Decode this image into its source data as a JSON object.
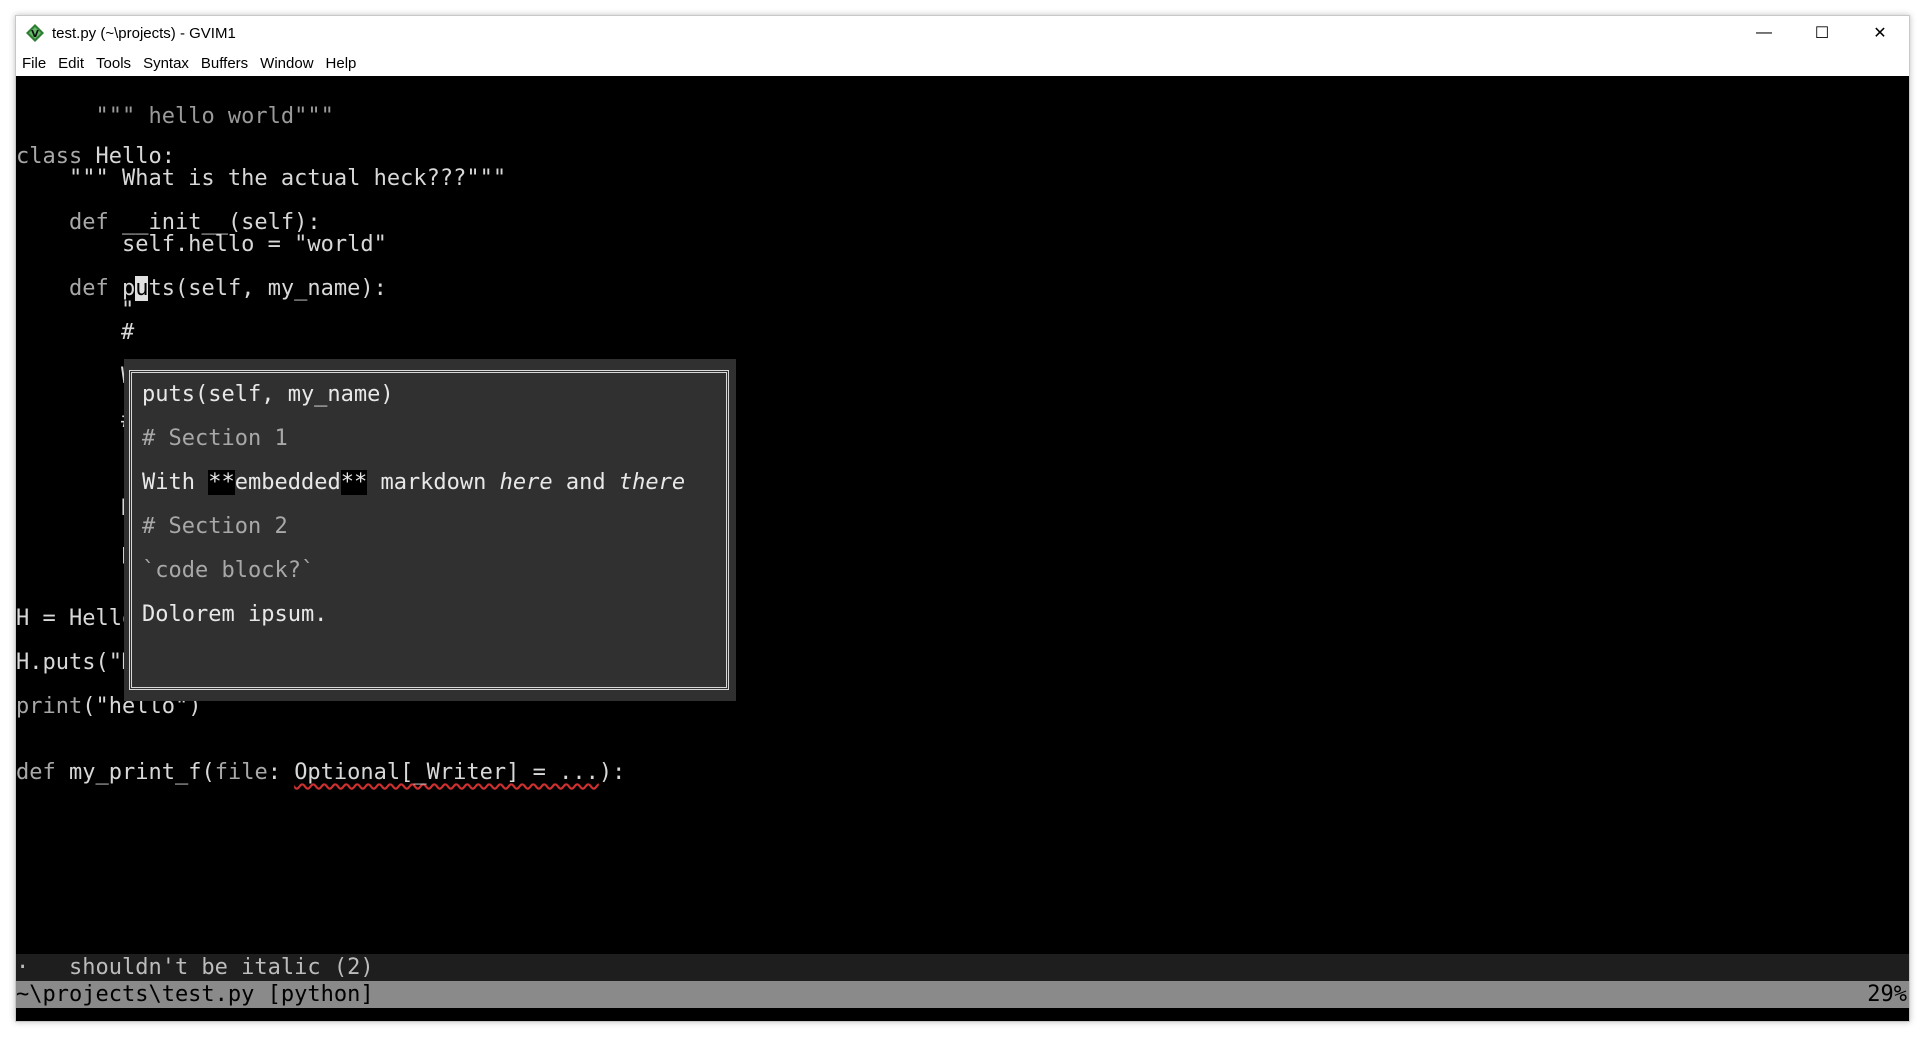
{
  "window": {
    "title": "test.py (~\\projects) - GVIM1",
    "controls": {
      "minimize": "—",
      "maximize": "☐",
      "close": "✕"
    }
  },
  "menu": [
    "File",
    "Edit",
    "Tools",
    "Syntax",
    "Buffers",
    "Window",
    "Help"
  ],
  "code": {
    "l1": "\"\"\" hello world\"\"\"",
    "l4_kw": "class",
    "l4_rest": " Hello:",
    "l5": "    \"\"\" What is the actual heck???\"\"\"",
    "l7_indent": "    ",
    "l7_kw": "def",
    "l7_rest": " __init__(self):",
    "l8": "        self.hello = \"world\"",
    "l10_indent": "    ",
    "l10_kw": "def",
    "l10_pre": " p",
    "l10_cursor": "u",
    "l10_post": "ts(self, my_name):",
    "peek": [
      "\"",
      "#",
      "W",
      "#",
      "`",
      "D",
      "\"",
      "p"
    ],
    "l16": "H = Hello()",
    "l18": "H.puts(\"My name\")",
    "l20_kw": "print",
    "l20_rest": "(\"hello\")",
    "l23_kw": "def",
    "l23_name": " my_print_f(",
    "l23_param": "file",
    "l23_colon": ": ",
    "l23_squiggle": "Optional[_Writer] = ...",
    "l23_end": "):"
  },
  "popup": {
    "signature": "puts(self, my_name)",
    "section1": "# Section 1",
    "with": "With ",
    "bold_open": "**",
    "embedded": "embedded",
    "bold_close": "**",
    "markdown": " markdown ",
    "here": "here",
    "and": " and ",
    "there": "there",
    "section2": "# Section 2",
    "code_block": "`code block?`",
    "dolorem": "Dolorem ipsum."
  },
  "messages": {
    "message_line": "·   shouldn't be italic (2)",
    "status_file": "~\\projects\\test.py [python]",
    "status_percent": "29%"
  },
  "colors": {
    "editor_bg": "#000000",
    "popup_bg": "#303030",
    "statusline_bg": "#8a8a8a"
  }
}
